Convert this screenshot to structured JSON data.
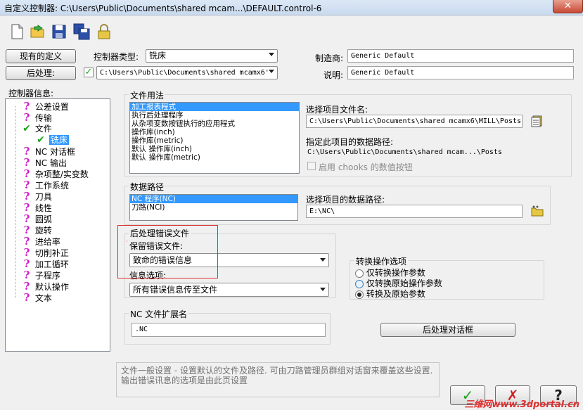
{
  "window": {
    "title": "自定义控制器: C:\\Users\\Public\\Documents\\shared mcam...\\DEFAULT.control-6",
    "close": "✕"
  },
  "toolbar": {
    "icons": [
      "new-icon",
      "open-icon",
      "save-icon",
      "save-all-icon",
      "lock-icon"
    ]
  },
  "top": {
    "current_def_btn": "现有的定义",
    "post_btn": "后处理:",
    "controller_type_label": "控制器类型:",
    "controller_type_value": "铣床",
    "post_path": "C:\\Users\\Public\\Documents\\shared mcamx6'",
    "maker_label": "制造商:",
    "maker_value": "Generic Default",
    "desc_label": "说明:",
    "desc_value": "Generic Default"
  },
  "tree": {
    "label": "控制器信息:",
    "items": [
      {
        "label": "公差设置",
        "icon": "question-icon"
      },
      {
        "label": "传输",
        "icon": "question-icon"
      },
      {
        "label": "文件",
        "icon": "check-icon"
      },
      {
        "label": "铣床",
        "icon": "check-icon"
      },
      {
        "label": "NC 对话框",
        "icon": "question-icon"
      },
      {
        "label": "NC 输出",
        "icon": "question-icon"
      },
      {
        "label": "杂项整/实变数",
        "icon": "question-icon"
      },
      {
        "label": "工作系统",
        "icon": "question-icon"
      },
      {
        "label": "刀具",
        "icon": "question-icon"
      },
      {
        "label": "线性",
        "icon": "question-icon"
      },
      {
        "label": "圆弧",
        "icon": "question-icon"
      },
      {
        "label": "旋转",
        "icon": "question-icon"
      },
      {
        "label": "进给率",
        "icon": "question-icon"
      },
      {
        "label": "切削补正",
        "icon": "question-icon"
      },
      {
        "label": "加工循环",
        "icon": "question-icon"
      },
      {
        "label": "子程序",
        "icon": "question-icon"
      },
      {
        "label": "默认操作",
        "icon": "question-icon"
      },
      {
        "label": "文本",
        "icon": "question-icon"
      }
    ]
  },
  "file_usage": {
    "title": "文件用法",
    "items": [
      "加工报表程式",
      "执行后处理程序",
      "从杂项变数按钮执行的应用程式",
      "操作库(inch)",
      "操作库(metric)",
      "默认 操作库(inch)",
      "默认 操作库(metric)"
    ],
    "select_file_label": "选择项目文件名:",
    "select_file_value": "C:\\Users\\Public\\Documents\\shared mcamx6\\MILL\\Posts'",
    "data_path_label": "指定此项目的数据路径:",
    "data_path_value": "C:\\Users\\Public\\Documents\\shared mcam...\\Posts",
    "chooks_label": "启用 chooks 的数值按钮"
  },
  "data_path": {
    "title": "数据路径",
    "items": [
      "NC 程序(NC)",
      "刀路(NCI)"
    ],
    "select_label": "选择项目的数据路径:",
    "select_value": "E:\\NC\\"
  },
  "post_error": {
    "title": "后处理错误文件",
    "keep_label": "保留错误文件:",
    "keep_value": "致命的错误信息",
    "info_label": "信息选项:",
    "info_value": "所有错误信息传至文件"
  },
  "convert_ops": {
    "title": "转换操作选项",
    "options": [
      "仅转换操作参数",
      "仅转换原始操作参数",
      "转换及原始参数"
    ],
    "selected_index": 2
  },
  "nc_ext": {
    "title": "NC 文件扩展名",
    "value": ".NC"
  },
  "post_dialog_btn": "后处理对话框",
  "help_text": "文件一般设置 - 设置默认的文件及路径. 可由刀路管理员群组对话窗来覆盖这些设置. 输出错误讯息的选项是由此页设置",
  "buttons": {
    "ok": "✓",
    "cancel": "✗",
    "help": "?"
  },
  "watermark": "三维网www.3dportal.cn",
  "colors": {
    "selection": "#3399ff",
    "question": "#d01cc9",
    "check": "#1aa31a",
    "highlight_box": "#e03030"
  }
}
